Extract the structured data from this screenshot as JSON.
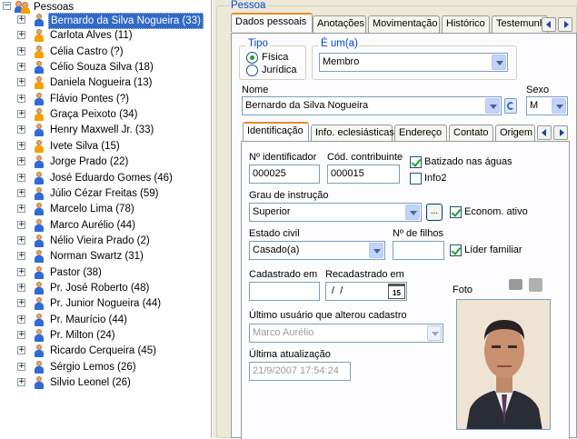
{
  "tree": {
    "root": "Pessoas",
    "items": [
      {
        "label": "Bernardo da Silva Nogueira (33)",
        "gender": "m",
        "selected": true
      },
      {
        "label": "Carlota Alves (11)",
        "gender": "f"
      },
      {
        "label": "Célia Castro (?)",
        "gender": "f"
      },
      {
        "label": "Célio Souza Silva (18)",
        "gender": "m"
      },
      {
        "label": "Daniela Nogueira (13)",
        "gender": "f"
      },
      {
        "label": "Flávio Pontes (?)",
        "gender": "m"
      },
      {
        "label": "Graça Peixoto (34)",
        "gender": "f"
      },
      {
        "label": "Henry Maxwell Jr. (33)",
        "gender": "m"
      },
      {
        "label": "Ivete Silva (15)",
        "gender": "f"
      },
      {
        "label": "Jorge Prado (22)",
        "gender": "m"
      },
      {
        "label": "José Eduardo Gomes (46)",
        "gender": "m"
      },
      {
        "label": "Júlio Cézar Freitas (59)",
        "gender": "m"
      },
      {
        "label": "Marcelo Lima (78)",
        "gender": "m"
      },
      {
        "label": "Marco Aurélio (44)",
        "gender": "m"
      },
      {
        "label": "Nélio Vieira Prado (2)",
        "gender": "m"
      },
      {
        "label": "Norman Swartz (31)",
        "gender": "m"
      },
      {
        "label": "Pastor (38)",
        "gender": "m"
      },
      {
        "label": "Pr. José Roberto (48)",
        "gender": "m"
      },
      {
        "label": "Pr. Junior Nogueira (44)",
        "gender": "m"
      },
      {
        "label": "Pr. Maurício (44)",
        "gender": "m"
      },
      {
        "label": "Pr. Milton (24)",
        "gender": "m"
      },
      {
        "label": "Ricardo Cerqueira (45)",
        "gender": "m"
      },
      {
        "label": "Sérgio Lemos (26)",
        "gender": "m"
      },
      {
        "label": "Silvio Leonel (26)",
        "gender": "m"
      }
    ]
  },
  "group_title": "Pessoa",
  "main_tabs": [
    "Dados pessoais",
    "Anotações",
    "Movimentação",
    "Histórico",
    "Testemunho"
  ],
  "tipo": {
    "title": "Tipo",
    "options": [
      "Física",
      "Jurídica"
    ],
    "selected": 0
  },
  "e_um": {
    "title": "É um(a)",
    "value": "Membro"
  },
  "nome": {
    "label": "Nome",
    "value": "Bernardo da Silva Nogueira"
  },
  "sexo": {
    "label": "Sexo",
    "value": "M"
  },
  "sub_tabs": [
    "Identificação",
    "Info. eclesiásticas",
    "Endereço",
    "Contato",
    "Origem"
  ],
  "ident": {
    "id_label": "Nº identificador",
    "id_value": "000025",
    "cod_label": "Cód. contribuinte",
    "cod_value": "000015",
    "batizado": "Batizado nas águas",
    "info2": "Info2",
    "grau_label": "Grau de instrução",
    "grau_value": "Superior",
    "econom": "Econom. ativo",
    "estado_label": "Estado civil",
    "estado_value": "Casado(a)",
    "filhos_label": "Nº de filhos",
    "filhos_value": "",
    "lider": "Líder familiar",
    "cadastrado_label": "Cadastrado em",
    "cadastrado_value": "",
    "recadastrado_label": "Recadastrado em",
    "recadastrado_value": " /  /",
    "calendar_day": "15",
    "foto_label": "Foto",
    "ultimo_label": "Último usuário que alterou cadastro",
    "ultimo_value": "Marco Aurélio",
    "atualizacao_label": "Última atualização",
    "atualizacao_value": "21/9/2007 17:54:24"
  },
  "browse_label": "...",
  "colors": {
    "accent": "#316ac5",
    "tab_hot": "#e68b2c",
    "group_title": "#0046d5"
  }
}
